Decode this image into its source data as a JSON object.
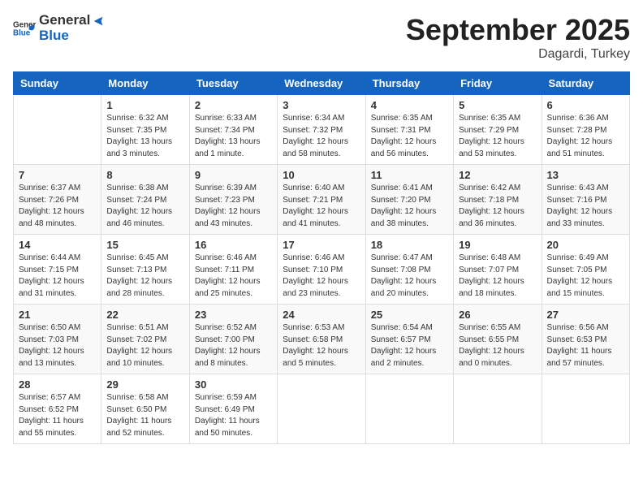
{
  "header": {
    "logo_general": "General",
    "logo_blue": "Blue",
    "month": "September 2025",
    "location": "Dagardi, Turkey"
  },
  "weekdays": [
    "Sunday",
    "Monday",
    "Tuesday",
    "Wednesday",
    "Thursday",
    "Friday",
    "Saturday"
  ],
  "weeks": [
    [
      {
        "day": "",
        "info": ""
      },
      {
        "day": "1",
        "info": "Sunrise: 6:32 AM\nSunset: 7:35 PM\nDaylight: 13 hours\nand 3 minutes."
      },
      {
        "day": "2",
        "info": "Sunrise: 6:33 AM\nSunset: 7:34 PM\nDaylight: 13 hours\nand 1 minute."
      },
      {
        "day": "3",
        "info": "Sunrise: 6:34 AM\nSunset: 7:32 PM\nDaylight: 12 hours\nand 58 minutes."
      },
      {
        "day": "4",
        "info": "Sunrise: 6:35 AM\nSunset: 7:31 PM\nDaylight: 12 hours\nand 56 minutes."
      },
      {
        "day": "5",
        "info": "Sunrise: 6:35 AM\nSunset: 7:29 PM\nDaylight: 12 hours\nand 53 minutes."
      },
      {
        "day": "6",
        "info": "Sunrise: 6:36 AM\nSunset: 7:28 PM\nDaylight: 12 hours\nand 51 minutes."
      }
    ],
    [
      {
        "day": "7",
        "info": "Sunrise: 6:37 AM\nSunset: 7:26 PM\nDaylight: 12 hours\nand 48 minutes."
      },
      {
        "day": "8",
        "info": "Sunrise: 6:38 AM\nSunset: 7:24 PM\nDaylight: 12 hours\nand 46 minutes."
      },
      {
        "day": "9",
        "info": "Sunrise: 6:39 AM\nSunset: 7:23 PM\nDaylight: 12 hours\nand 43 minutes."
      },
      {
        "day": "10",
        "info": "Sunrise: 6:40 AM\nSunset: 7:21 PM\nDaylight: 12 hours\nand 41 minutes."
      },
      {
        "day": "11",
        "info": "Sunrise: 6:41 AM\nSunset: 7:20 PM\nDaylight: 12 hours\nand 38 minutes."
      },
      {
        "day": "12",
        "info": "Sunrise: 6:42 AM\nSunset: 7:18 PM\nDaylight: 12 hours\nand 36 minutes."
      },
      {
        "day": "13",
        "info": "Sunrise: 6:43 AM\nSunset: 7:16 PM\nDaylight: 12 hours\nand 33 minutes."
      }
    ],
    [
      {
        "day": "14",
        "info": "Sunrise: 6:44 AM\nSunset: 7:15 PM\nDaylight: 12 hours\nand 31 minutes."
      },
      {
        "day": "15",
        "info": "Sunrise: 6:45 AM\nSunset: 7:13 PM\nDaylight: 12 hours\nand 28 minutes."
      },
      {
        "day": "16",
        "info": "Sunrise: 6:46 AM\nSunset: 7:11 PM\nDaylight: 12 hours\nand 25 minutes."
      },
      {
        "day": "17",
        "info": "Sunrise: 6:46 AM\nSunset: 7:10 PM\nDaylight: 12 hours\nand 23 minutes."
      },
      {
        "day": "18",
        "info": "Sunrise: 6:47 AM\nSunset: 7:08 PM\nDaylight: 12 hours\nand 20 minutes."
      },
      {
        "day": "19",
        "info": "Sunrise: 6:48 AM\nSunset: 7:07 PM\nDaylight: 12 hours\nand 18 minutes."
      },
      {
        "day": "20",
        "info": "Sunrise: 6:49 AM\nSunset: 7:05 PM\nDaylight: 12 hours\nand 15 minutes."
      }
    ],
    [
      {
        "day": "21",
        "info": "Sunrise: 6:50 AM\nSunset: 7:03 PM\nDaylight: 12 hours\nand 13 minutes."
      },
      {
        "day": "22",
        "info": "Sunrise: 6:51 AM\nSunset: 7:02 PM\nDaylight: 12 hours\nand 10 minutes."
      },
      {
        "day": "23",
        "info": "Sunrise: 6:52 AM\nSunset: 7:00 PM\nDaylight: 12 hours\nand 8 minutes."
      },
      {
        "day": "24",
        "info": "Sunrise: 6:53 AM\nSunset: 6:58 PM\nDaylight: 12 hours\nand 5 minutes."
      },
      {
        "day": "25",
        "info": "Sunrise: 6:54 AM\nSunset: 6:57 PM\nDaylight: 12 hours\nand 2 minutes."
      },
      {
        "day": "26",
        "info": "Sunrise: 6:55 AM\nSunset: 6:55 PM\nDaylight: 12 hours\nand 0 minutes."
      },
      {
        "day": "27",
        "info": "Sunrise: 6:56 AM\nSunset: 6:53 PM\nDaylight: 11 hours\nand 57 minutes."
      }
    ],
    [
      {
        "day": "28",
        "info": "Sunrise: 6:57 AM\nSunset: 6:52 PM\nDaylight: 11 hours\nand 55 minutes."
      },
      {
        "day": "29",
        "info": "Sunrise: 6:58 AM\nSunset: 6:50 PM\nDaylight: 11 hours\nand 52 minutes."
      },
      {
        "day": "30",
        "info": "Sunrise: 6:59 AM\nSunset: 6:49 PM\nDaylight: 11 hours\nand 50 minutes."
      },
      {
        "day": "",
        "info": ""
      },
      {
        "day": "",
        "info": ""
      },
      {
        "day": "",
        "info": ""
      },
      {
        "day": "",
        "info": ""
      }
    ]
  ]
}
